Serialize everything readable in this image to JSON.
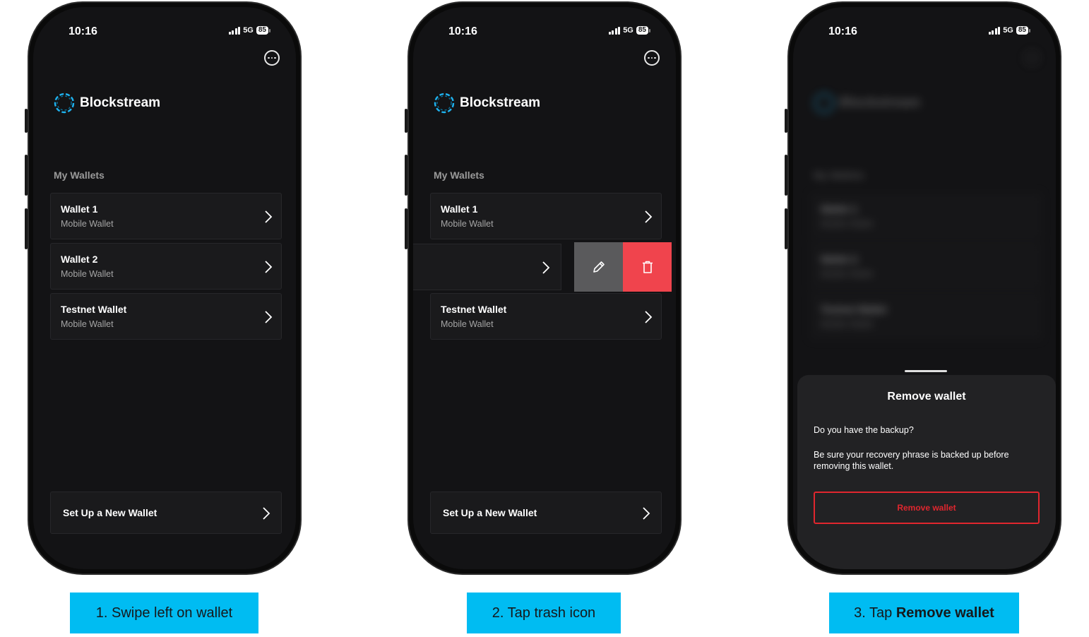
{
  "status": {
    "time": "10:16",
    "network": "5G",
    "battery": "85"
  },
  "app": {
    "brand": "Blockstream",
    "section_label": "My Wallets",
    "setup_label": "Set Up a New Wallet",
    "more_icon": "more-icon"
  },
  "wallets": [
    {
      "name": "Wallet 1",
      "type": "Mobile Wallet"
    },
    {
      "name": "Wallet 2",
      "type": "Mobile Wallet"
    },
    {
      "name": "Testnet Wallet",
      "type": "Mobile Wallet"
    }
  ],
  "swipe_actions": {
    "edit_icon": "pencil-icon",
    "delete_icon": "trash-icon",
    "delete_color": "#f0444d",
    "edit_color": "#5a5a5c"
  },
  "remove_sheet": {
    "title": "Remove wallet",
    "question": "Do you have the backup?",
    "body": "Be sure your recovery phrase is backed up before removing this wallet.",
    "button_label": "Remove wallet",
    "button_color": "#e0262e"
  },
  "captions": {
    "step1": "1. Swipe left on wallet",
    "step2": "2. Tap trash icon",
    "step3_prefix": "3. Tap ",
    "step3_bold": "Remove wallet"
  },
  "colors": {
    "caption_bg": "#00bcf2",
    "screen_bg": "#131315",
    "card_bg": "#1a1a1c"
  }
}
